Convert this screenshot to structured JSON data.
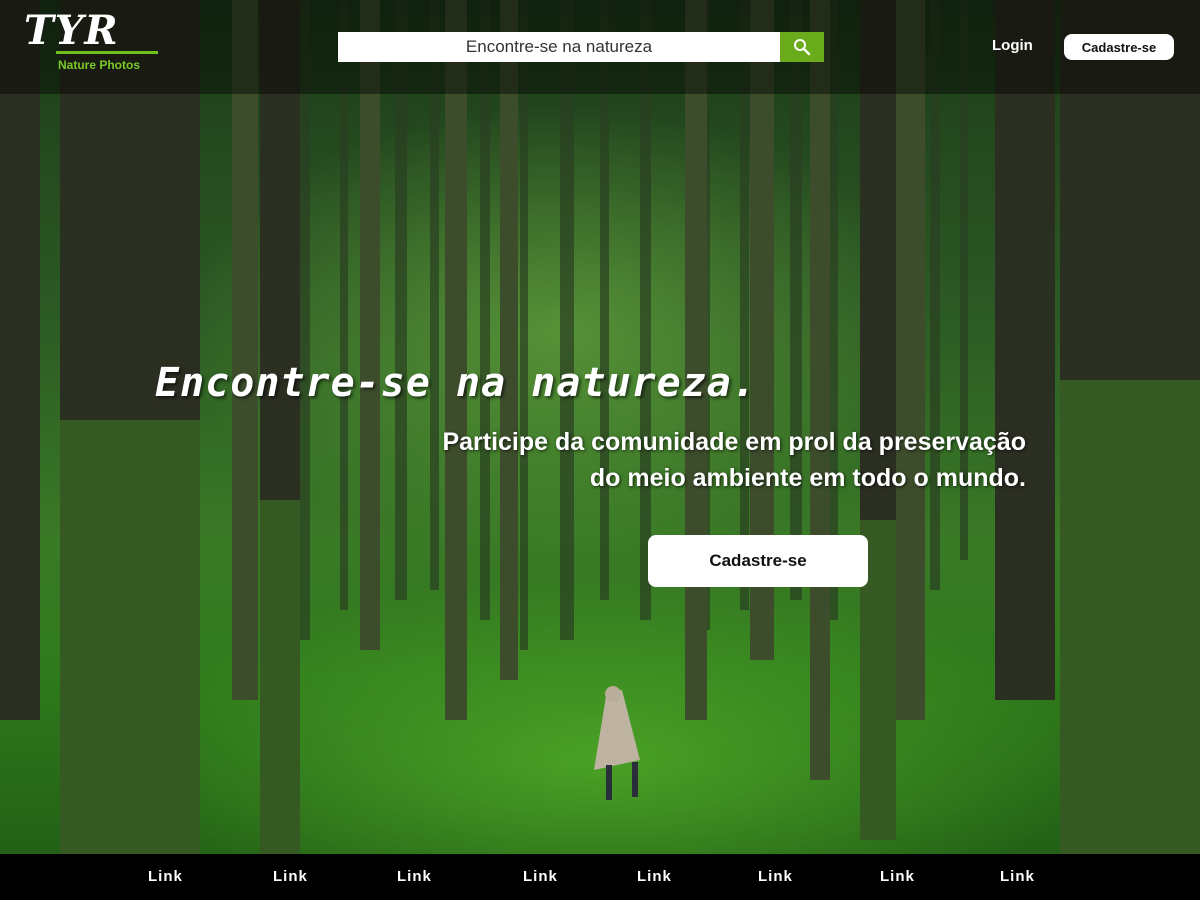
{
  "brand": {
    "logo_text": "TYR",
    "tagline": "Nature Photos"
  },
  "search": {
    "placeholder": "Encontre-se na natureza",
    "icon": "search-icon"
  },
  "header": {
    "login_label": "Login",
    "signup_label": "Cadastre-se"
  },
  "hero": {
    "headline": "Encontre-se na natureza.",
    "subtitle_line1": "Participe da comunidade em prol da preservação",
    "subtitle_line2": "do meio ambiente em todo o mundo.",
    "cta_label": "Cadastre-se"
  },
  "footer": {
    "links": [
      "Link",
      "Link",
      "Link",
      "Link",
      "Link",
      "Link",
      "Link",
      "Link"
    ]
  },
  "colors": {
    "accent": "#6aab1c",
    "topbar": "rgba(0,0,0,0.42)",
    "footer": "#000000"
  }
}
